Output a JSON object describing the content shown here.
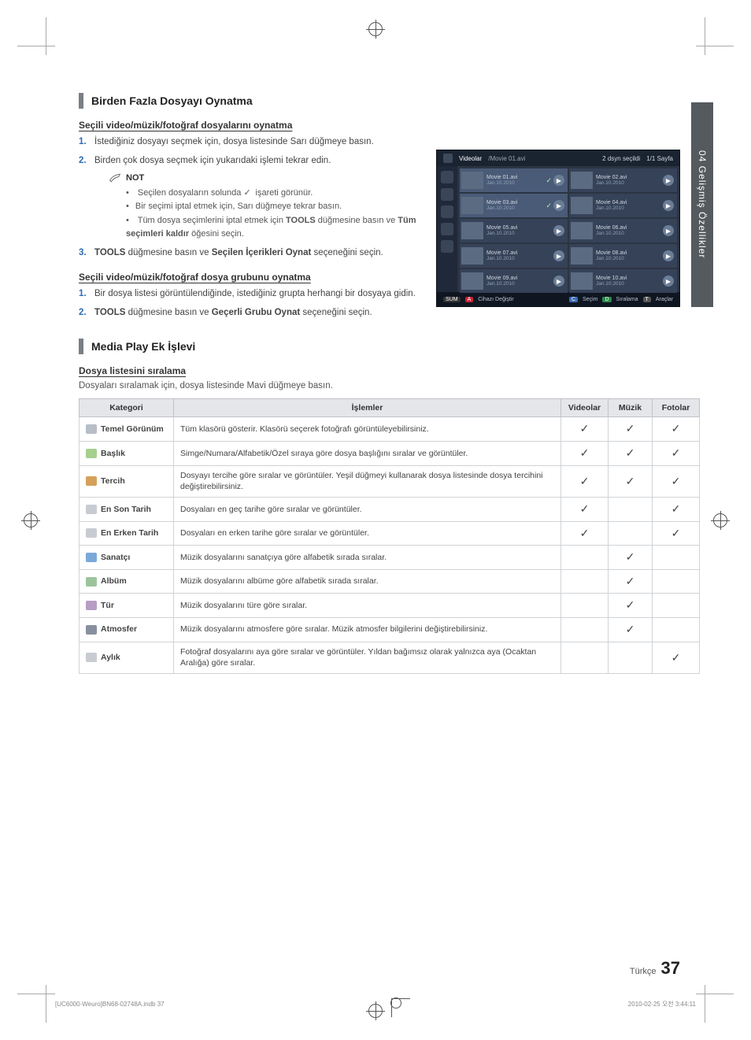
{
  "side_tab": "04  Gelişmiş Özellikler",
  "section1": {
    "title": "Birden Fazla Dosyayı Oynatma",
    "sub1": "Seçili video/müzik/fotoğraf dosyalarını oynatma",
    "step1": "İstediğiniz dosyayı seçmek için, dosya listesinde Sarı düğmeye basın.",
    "step2": "Birden çok dosya seçmek için yukarıdaki işlemi tekrar edin.",
    "note_label": "NOT",
    "bul1_a": "Seçilen dosyaların solunda ",
    "bul1_b": " işareti görünür.",
    "bul2": "Bir seçimi iptal etmek için, Sarı düğmeye tekrar basın.",
    "bul3_a": "Tüm dosya seçimlerini iptal etmek için ",
    "bul3_b": "TOOLS",
    "bul3_c": " düğmesine basın ve ",
    "bul3_d": "Tüm seçimleri kaldır",
    "bul3_e": " öğesini seçin.",
    "step3_a": "TOOLS",
    "step3_b": " düğmesine basın ve ",
    "step3_c": "Seçilen İçerikleri Oynat",
    "step3_d": " seçeneğini seçin.",
    "sub2": "Seçili video/müzik/fotoğraf dosya grubunu oynatma",
    "g_step1": "Bir dosya listesi görüntülendiğinde, istediğiniz grupta herhangi bir dosyaya gidin.",
    "g_step2_a": "TOOLS",
    "g_step2_b": " düğmesine basın ve ",
    "g_step2_c": "Geçerli Grubu Oynat",
    "g_step2_d": " seçeneğini seçin."
  },
  "screenshot": {
    "header_title": "Videolar",
    "header_path": "/Movie 01.avi",
    "header_sel": "2 dsyn seçildi",
    "header_page": "1/1 Sayfa",
    "items": [
      {
        "name": "Movie 01.avi",
        "date": "Jan.10.2010",
        "sel": true,
        "chk": true
      },
      {
        "name": "Movie 02.avi",
        "date": "Jan.10.2010",
        "sel": false
      },
      {
        "name": "Movie 03.avi",
        "date": "Jan.10.2010",
        "sel": true,
        "chk": true
      },
      {
        "name": "Movie 04.avi",
        "date": "Jan.10.2010",
        "sel": false
      },
      {
        "name": "Movie 05.avi",
        "date": "Jan.10.2010",
        "sel": false
      },
      {
        "name": "Movie 06.avi",
        "date": "Jan.10.2010",
        "sel": false
      },
      {
        "name": "Movie 07.avi",
        "date": "Jan.10.2010",
        "sel": false
      },
      {
        "name": "Movie 08.avi",
        "date": "Jan.10.2010",
        "sel": false
      },
      {
        "name": "Movie 09.avi",
        "date": "Jan.10.2010",
        "sel": false
      },
      {
        "name": "Movie 10.avi",
        "date": "Jan.10.2010",
        "sel": false
      }
    ],
    "footer_left_sum": "SUM",
    "footer_left_a": "A",
    "footer_left_txt": "Cihazı Değiştir",
    "footer_c": "C",
    "footer_c_txt": "Seçim",
    "footer_d": "D",
    "footer_d_txt": "Sıralama",
    "footer_t": "T",
    "footer_t_txt": "Araçlar"
  },
  "section2": {
    "title": "Media Play Ek İşlevi",
    "sub": "Dosya listesini sıralama",
    "intro": "Dosyaları sıralamak için, dosya listesinde Mavi düğmeye basın."
  },
  "table": {
    "h_cat": "Kategori",
    "h_ops": "İşlemler",
    "h_vid": "Videolar",
    "h_mus": "Müzik",
    "h_pho": "Fotolar",
    "rows": [
      {
        "cat": "Temel Görünüm",
        "ops": "Tüm klasörü gösterir. Klasörü seçerek fotoğrafı görüntüleyebilirsiniz.",
        "v": true,
        "m": true,
        "p": true,
        "ic": "ci-folder"
      },
      {
        "cat": "Başlık",
        "ops": "Simge/Numara/Alfabetik/Özel sıraya göre dosya başlığını sıralar ve görüntüler.",
        "v": true,
        "m": true,
        "p": true,
        "ic": "ci-title"
      },
      {
        "cat": "Tercih",
        "ops": "Dosyayı tercihe göre sıralar ve görüntüler. Yeşil düğmeyi kullanarak dosya listesinde dosya tercihini değiştirebilirsiniz.",
        "v": true,
        "m": true,
        "p": true,
        "ic": "ci-star"
      },
      {
        "cat": "En Son Tarih",
        "ops": "Dosyaları en geç tarihe göre sıralar ve görüntüler.",
        "v": true,
        "m": false,
        "p": true,
        "ic": "ci-date1"
      },
      {
        "cat": "En Erken Tarih",
        "ops": "Dosyaları en erken tarihe göre sıralar ve görüntüler.",
        "v": true,
        "m": false,
        "p": true,
        "ic": "ci-date2"
      },
      {
        "cat": "Sanatçı",
        "ops": "Müzik dosyalarını sanatçıya göre alfabetik sırada sıralar.",
        "v": false,
        "m": true,
        "p": false,
        "ic": "ci-artist"
      },
      {
        "cat": "Albüm",
        "ops": "Müzik dosyalarını albüme göre alfabetik sırada sıralar.",
        "v": false,
        "m": true,
        "p": false,
        "ic": "ci-album"
      },
      {
        "cat": "Tür",
        "ops": "Müzik dosyalarını türe göre sıralar.",
        "v": false,
        "m": true,
        "p": false,
        "ic": "ci-genre"
      },
      {
        "cat": "Atmosfer",
        "ops": "Müzik dosyalarını atmosfere göre sıralar. Müzik atmosfer bilgilerini değiştirebilirsiniz.",
        "v": false,
        "m": true,
        "p": false,
        "ic": "ci-mood"
      },
      {
        "cat": "Aylık",
        "ops": "Fotoğraf dosyalarını aya göre sıralar ve görüntüler. Yıldan bağımsız olarak yalnızca aya (Ocaktan Aralığa) göre sıralar.",
        "v": false,
        "m": false,
        "p": true,
        "ic": "ci-month"
      }
    ]
  },
  "footer": {
    "lang": "Türkçe",
    "page": "37"
  },
  "docfooter": {
    "left": "[UC6000-Weuro]BN68-02748A.indb   37",
    "right": "2010-02-25   오전 3:44:11"
  }
}
